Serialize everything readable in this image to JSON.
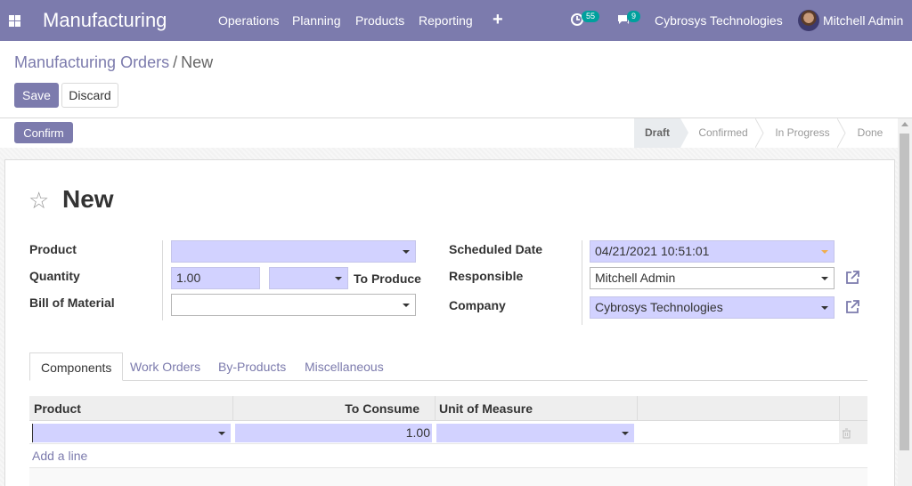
{
  "navbar": {
    "brand": "Manufacturing",
    "menu": [
      "Operations",
      "Planning",
      "Products",
      "Reporting"
    ],
    "activity_badge": "55",
    "messages_badge": "9",
    "company": "Cybrosys Technologies",
    "user": "Mitchell Admin"
  },
  "breadcrumb": {
    "parent": "Manufacturing Orders",
    "separator": "/",
    "current": "New"
  },
  "buttons": {
    "save": "Save",
    "discard": "Discard",
    "confirm": "Confirm"
  },
  "statusbar": {
    "stages": [
      "Draft",
      "Confirmed",
      "In Progress",
      "Done"
    ],
    "active": "Draft"
  },
  "record": {
    "title": "New"
  },
  "form": {
    "product_label": "Product",
    "product_value": "",
    "quantity_label": "Quantity",
    "quantity_value": "1.00",
    "uom_value": "",
    "to_produce_label": "To Produce",
    "bom_label": "Bill of Material",
    "bom_value": "",
    "scheduled_label": "Scheduled Date",
    "scheduled_value": "04/21/2021 10:51:01",
    "responsible_label": "Responsible",
    "responsible_value": "Mitchell Admin",
    "company_label": "Company",
    "company_value": "Cybrosys Technologies"
  },
  "tabs": [
    "Components",
    "Work Orders",
    "By-Products",
    "Miscellaneous"
  ],
  "active_tab": "Components",
  "table": {
    "columns": [
      "Product",
      "To Consume",
      "Unit of Measure"
    ],
    "row": {
      "product": "",
      "to_consume": "1.00",
      "uom": ""
    },
    "add_line": "Add a line"
  },
  "colors": {
    "brand": "#7c7bad",
    "required_field": "#d2d2ff",
    "badge": "#00a09d"
  }
}
